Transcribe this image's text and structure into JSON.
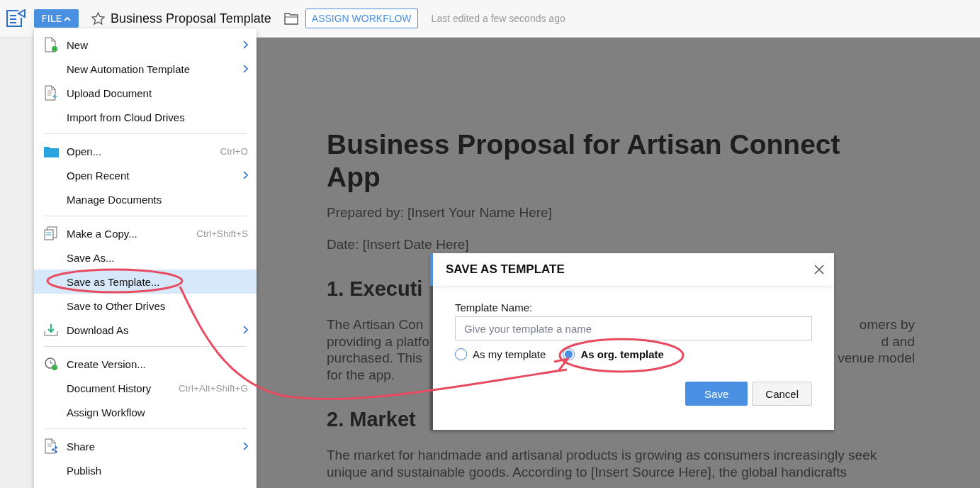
{
  "topbar": {
    "file_button": "FILE",
    "document_title": "Business Proposal Template",
    "assign_button": "ASSIGN WORKFLOW",
    "last_edited": "Last edited a few seconds ago"
  },
  "file_menu": {
    "groups": [
      [
        {
          "label": "New",
          "submenu": true,
          "selected": false
        },
        {
          "label": "New Automation Template",
          "submenu": true,
          "selected": false
        },
        {
          "label": "Upload Document",
          "submenu": false,
          "selected": false
        },
        {
          "label": "Import from Cloud Drives",
          "submenu": false,
          "selected": false
        }
      ],
      [
        {
          "label": "Open...",
          "shortcut": "Ctrl+O",
          "submenu": false,
          "selected": false
        },
        {
          "label": "Open Recent",
          "submenu": true,
          "selected": false
        },
        {
          "label": "Manage Documents",
          "submenu": false,
          "selected": false
        }
      ],
      [
        {
          "label": "Make a Copy...",
          "shortcut": "Ctrl+Shift+S",
          "submenu": false,
          "selected": false
        },
        {
          "label": "Save As...",
          "submenu": false,
          "selected": false
        },
        {
          "label": "Save as Template...",
          "submenu": false,
          "selected": true
        },
        {
          "label": "Save to Other Drives",
          "submenu": false,
          "selected": false
        },
        {
          "label": "Download As",
          "submenu": true,
          "selected": false
        }
      ],
      [
        {
          "label": "Create Version...",
          "submenu": false,
          "selected": false
        },
        {
          "label": "Document History",
          "shortcut": "Ctrl+Alt+Shift+G",
          "submenu": false,
          "selected": false
        },
        {
          "label": "Assign Workflow",
          "submenu": false,
          "selected": false
        }
      ],
      [
        {
          "label": "Share",
          "submenu": true,
          "selected": false
        },
        {
          "label": "Publish",
          "submenu": false,
          "selected": false
        }
      ]
    ]
  },
  "document": {
    "title": "Business Proposal for Artisan Connect App",
    "blocks": [
      {
        "kind": "para",
        "lines": [
          [
            "Prepared by: [Insert Your Name Here]"
          ]
        ]
      },
      {
        "kind": "para",
        "lines": [
          [
            "Date: [Insert Date Here]"
          ]
        ]
      },
      {
        "kind": "heading",
        "lines": [
          [
            "1. Executi"
          ]
        ]
      },
      {
        "kind": "para",
        "lines": [
          [
            "The Artisan Con",
            "omers by"
          ],
          [
            "providing a platfo",
            "d and"
          ],
          [
            "purchased. This",
            "venue model"
          ],
          [
            "for the app."
          ]
        ]
      },
      {
        "kind": "heading",
        "lines": [
          [
            "2. Market"
          ]
        ]
      },
      {
        "kind": "para",
        "lines": [
          [
            "The market for handmade and artisanal products is growing as consumers increasingly seek"
          ],
          [
            "unique and sustainable goods. According to [Insert Source Here], the global handicrafts"
          ]
        ]
      }
    ]
  },
  "dialog": {
    "title": "SAVE AS TEMPLATE",
    "field_label": "Template Name:",
    "placeholder": "Give your template a name",
    "options": [
      {
        "label": "As my template",
        "selected": false
      },
      {
        "label": "As org. template",
        "selected": true
      }
    ],
    "buttons": [
      {
        "label": "Save",
        "kind": "primary"
      },
      {
        "label": "Cancel",
        "kind": "secondary"
      }
    ]
  }
}
